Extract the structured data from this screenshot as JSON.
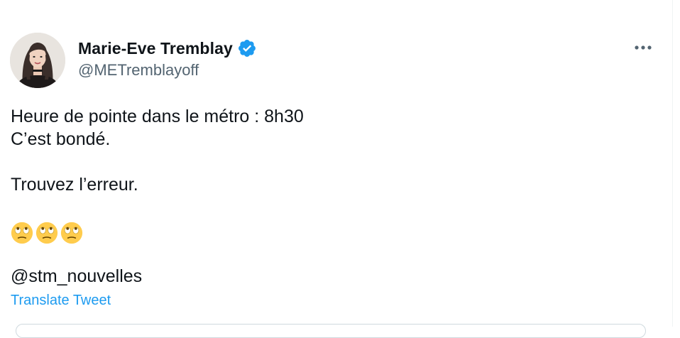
{
  "author": {
    "display_name": "Marie-Eve Tremblay",
    "handle": "@METremblayoff",
    "verified": true,
    "avatar_icon": "profile-photo"
  },
  "tweet": {
    "lines": [
      "Heure de pointe dans le métro : 8h30",
      "C’est bondé.",
      "Trouvez l’erreur."
    ],
    "emojis": [
      "face-with-rolling-eyes",
      "face-with-rolling-eyes",
      "face-with-rolling-eyes"
    ],
    "mention": "@stm_nouvelles",
    "translate_label": "Translate Tweet"
  },
  "colors": {
    "text": "#0f1419",
    "secondary": "#536471",
    "accent": "#1d9bf0",
    "border": "#cfd9de",
    "emoji": "#ffcc4d"
  },
  "icons": {
    "more": "more-icon",
    "verified": "verified-badge-icon"
  }
}
